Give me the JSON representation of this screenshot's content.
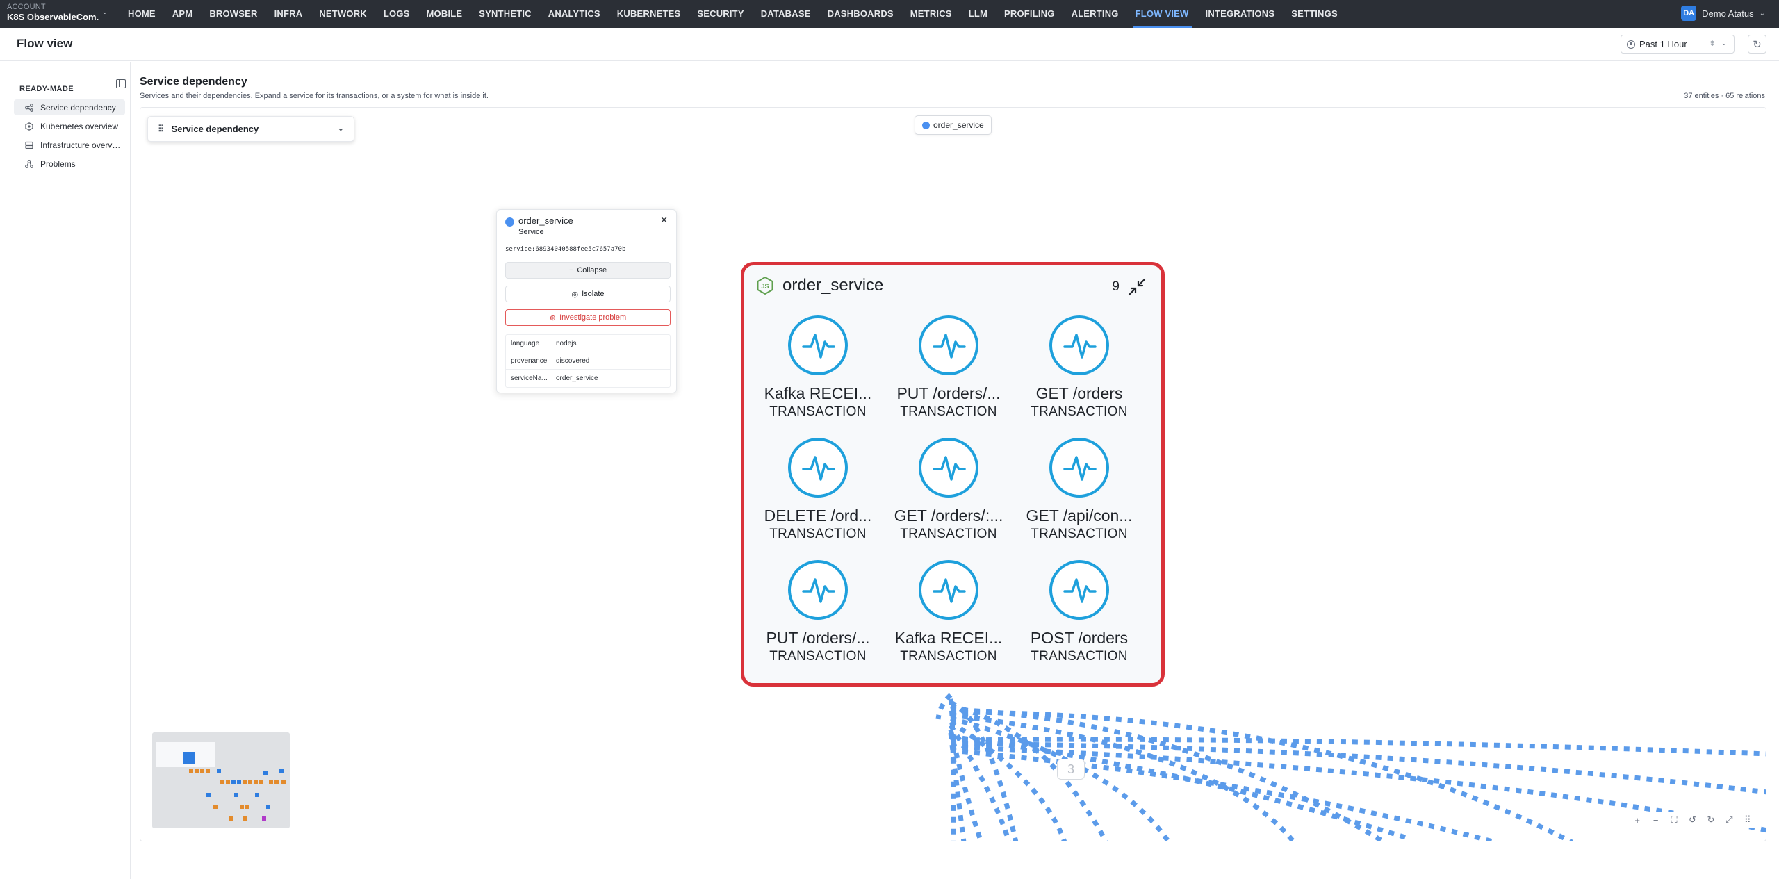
{
  "account": {
    "label": "ACCOUNT",
    "name": "K8S ObservableCom..."
  },
  "nav": {
    "items": [
      {
        "label": "HOME",
        "active": false
      },
      {
        "label": "APM",
        "active": false
      },
      {
        "label": "BROWSER",
        "active": false
      },
      {
        "label": "INFRA",
        "active": false
      },
      {
        "label": "NETWORK",
        "active": false
      },
      {
        "label": "LOGS",
        "active": false
      },
      {
        "label": "MOBILE",
        "active": false
      },
      {
        "label": "SYNTHETIC",
        "active": false
      },
      {
        "label": "ANALYTICS",
        "active": false
      },
      {
        "label": "KUBERNETES",
        "active": false
      },
      {
        "label": "SECURITY",
        "active": false
      },
      {
        "label": "DATABASE",
        "active": false
      },
      {
        "label": "DASHBOARDS",
        "active": false
      },
      {
        "label": "METRICS",
        "active": false
      },
      {
        "label": "LLM",
        "active": false
      },
      {
        "label": "PROFILING",
        "active": false
      },
      {
        "label": "ALERTING",
        "active": false
      },
      {
        "label": "FLOW VIEW",
        "active": true
      },
      {
        "label": "INTEGRATIONS",
        "active": false
      },
      {
        "label": "SETTINGS",
        "active": false
      }
    ],
    "user": {
      "initials": "DA",
      "name": "Demo Atatus"
    }
  },
  "page": {
    "title": "Flow view",
    "time_range": "Past 1 Hour"
  },
  "sidebar": {
    "section": "READY-MADE",
    "items": [
      {
        "label": "Service dependency",
        "icon": "share-icon",
        "active": true
      },
      {
        "label": "Kubernetes overview",
        "icon": "kubernetes-icon",
        "active": false
      },
      {
        "label": "Infrastructure overvi...",
        "icon": "server-icon",
        "active": false
      },
      {
        "label": "Problems",
        "icon": "problems-icon",
        "active": false
      }
    ]
  },
  "main": {
    "title": "Service dependency",
    "description": "Services and their dependencies. Expand a service for its transactions, or a system for what is inside it.",
    "stats": "37 entities · 65 relations",
    "view_select": "Service dependency",
    "breadcrumb": "order_service"
  },
  "info_panel": {
    "name": "order_service",
    "type": "Service",
    "id": "service:68934040588fee5c7657a70b",
    "collapse_label": "Collapse",
    "isolate_label": "Isolate",
    "investigate_label": "Investigate problem",
    "attributes": [
      {
        "key": "language",
        "value": "nodejs"
      },
      {
        "key": "provenance",
        "value": "discovered"
      },
      {
        "key": "serviceNa...",
        "value": "order_service"
      }
    ]
  },
  "group": {
    "title": "order_service",
    "count": "9",
    "transactions": [
      {
        "name": "Kafka RECEI...",
        "type": "TRANSACTION"
      },
      {
        "name": "PUT /orders/...",
        "type": "TRANSACTION"
      },
      {
        "name": "GET /orders",
        "type": "TRANSACTION"
      },
      {
        "name": "DELETE /ord...",
        "type": "TRANSACTION"
      },
      {
        "name": "GET /orders/:...",
        "type": "TRANSACTION"
      },
      {
        "name": "GET /api/con...",
        "type": "TRANSACTION"
      },
      {
        "name": "PUT /orders/...",
        "type": "TRANSACTION"
      },
      {
        "name": "Kafka RECEI...",
        "type": "TRANSACTION"
      },
      {
        "name": "POST /orders",
        "type": "TRANSACTION"
      }
    ]
  },
  "edge_label": "3",
  "colors": {
    "accent": "#4a90f0",
    "node_border": "#d9323a",
    "tx_ring": "#1ea0dc",
    "edge": "#5b9bea"
  }
}
